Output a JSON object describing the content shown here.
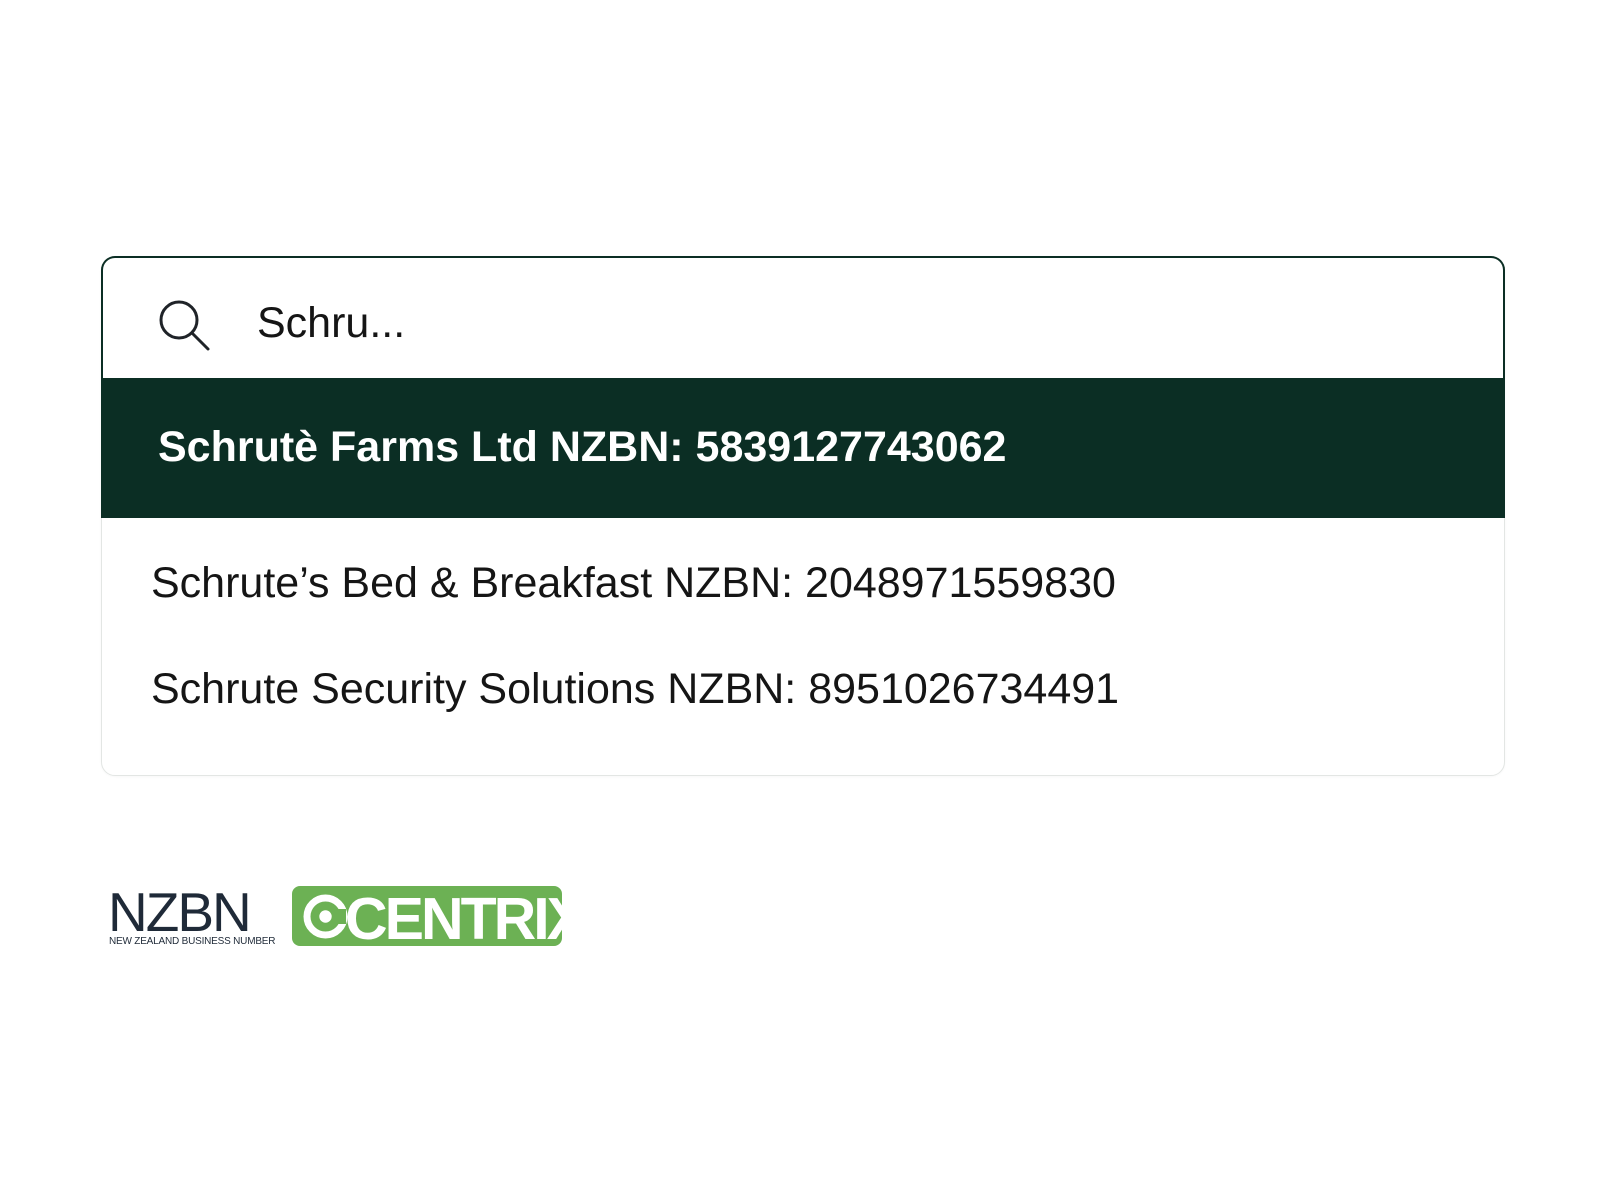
{
  "search": {
    "value": "Schru...",
    "icon": "search-icon"
  },
  "results": [
    {
      "label": "Schrutè Farms Ltd NZBN: 5839127743062",
      "selected": true
    },
    {
      "label": "Schrute’s Bed & Breakfast NZBN: 2048971559830",
      "selected": false
    },
    {
      "label": "Schrute Security Solutions NZBN: 8951026734491",
      "selected": false
    }
  ],
  "logos": {
    "nzbn": {
      "wordmark": "NZBN",
      "tagline": "NEW ZEALAND BUSINESS NUMBER"
    },
    "centrix": {
      "wordmark": "CENTRIX"
    }
  },
  "colors": {
    "selected_background": "#0b2e24",
    "selected_text": "#ffffff",
    "nzbn_dark": "#1f2a38",
    "nzbn_teal": "#2c9aa5",
    "centrix_green": "#6cb154"
  }
}
